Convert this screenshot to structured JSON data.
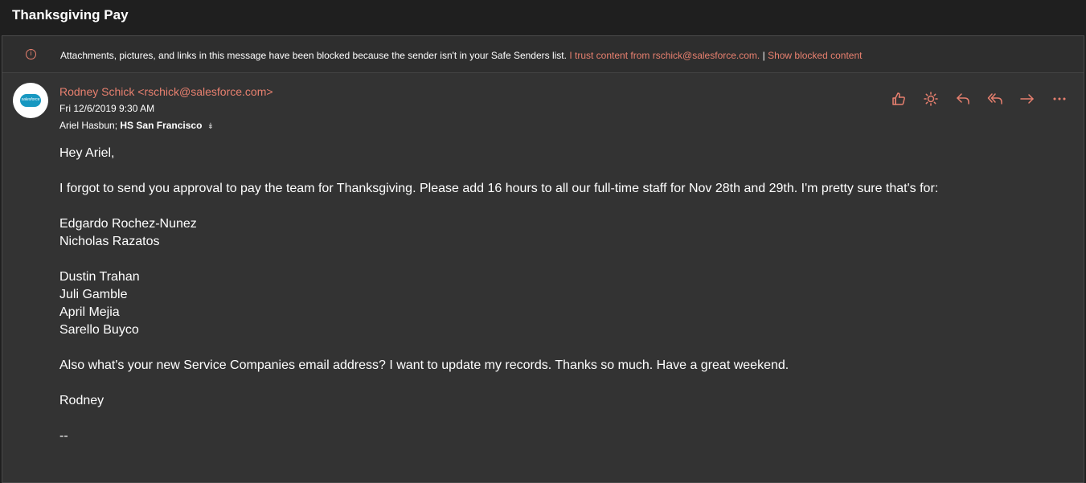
{
  "header": {
    "title": "Thanksgiving Pay"
  },
  "banner": {
    "message": "Attachments, pictures, and links in this message have been blocked because the sender isn't in your Safe Senders list.",
    "trust_link": "I trust content from rschick@salesforce.com.",
    "separator": "|",
    "show_link": "Show blocked content"
  },
  "avatar": {
    "logo_text": "salesforce"
  },
  "email": {
    "sender": "Rodney Schick <rschick@salesforce.com>",
    "date": "Fri 12/6/2019 9:30 AM",
    "recipient_1": "Ariel Hasbun;",
    "recipient_2": "HS San Francisco",
    "expand_icon": "chevron-double-down"
  },
  "actions": [
    {
      "name": "like",
      "icon": "thumbs-up-icon"
    },
    {
      "name": "sun",
      "icon": "sun-icon"
    },
    {
      "name": "reply",
      "icon": "reply-icon"
    },
    {
      "name": "reply-all",
      "icon": "reply-all-icon"
    },
    {
      "name": "forward",
      "icon": "forward-icon"
    },
    {
      "name": "more",
      "icon": "more-icon"
    }
  ],
  "body": {
    "greeting": "Hey Ariel,",
    "para1": "I forgot to send you approval to pay the team for Thanksgiving. Please add 16 hours to all our full-time staff for Nov 28th and 29th. I'm pretty sure that's for:",
    "group1": [
      "Edgardo Rochez-Nunez",
      "Nicholas Razatos"
    ],
    "group2": [
      "Dustin Trahan",
      "Juli Gamble",
      "April Mejia",
      "Sarello Buyco"
    ],
    "para2": "Also what's your new Service Companies email address? I want to update my records. Thanks so much. Have a great weekend.",
    "signoff": "Rodney",
    "signature": "--"
  },
  "colors": {
    "accent": "#e8806f",
    "background": "#333333",
    "header": "#1f1f1f"
  }
}
